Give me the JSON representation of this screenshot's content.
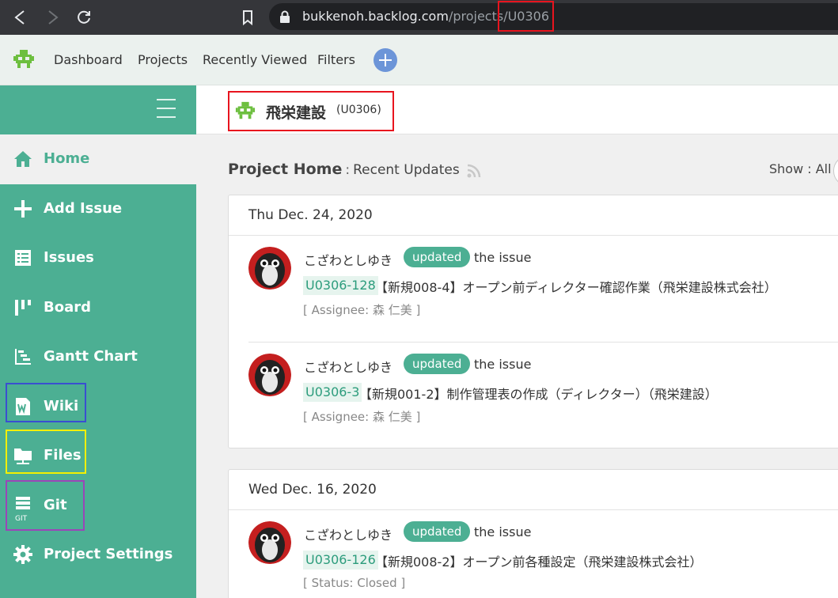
{
  "browser": {
    "url_host": "bukkenoh.backlog.com",
    "url_path": "/projects/",
    "url_key": "U0306"
  },
  "header": {
    "nav": [
      "Dashboard",
      "Projects",
      "Recently Viewed",
      "Filters"
    ]
  },
  "sidebar": {
    "items": [
      {
        "label": "Home",
        "icon": "home-icon"
      },
      {
        "label": "Add Issue",
        "icon": "plus-icon"
      },
      {
        "label": "Issues",
        "icon": "list-icon"
      },
      {
        "label": "Board",
        "icon": "board-icon"
      },
      {
        "label": "Gantt Chart",
        "icon": "gantt-icon"
      },
      {
        "label": "Wiki",
        "icon": "wiki-icon"
      },
      {
        "label": "Files",
        "icon": "files-icon"
      },
      {
        "label": "Git",
        "icon": "git-icon",
        "icon_caption": "GIT"
      },
      {
        "label": "Project Settings",
        "icon": "gear-icon"
      }
    ]
  },
  "project": {
    "name": "飛栄建設",
    "key": "(U0306)"
  },
  "main": {
    "title": "Project Home",
    "separator": ":",
    "subtitle": "Recent Updates",
    "show_label": "Show : All"
  },
  "updates": [
    {
      "date": "Thu Dec. 24, 2020",
      "entries": [
        {
          "user": "こざわとしゆき",
          "badge": "updated",
          "action": "the issue",
          "issue_key": "U0306-128",
          "issue_title": "【新規008-4】オープン前ディレクター確認作業（飛栄建設株式会社）",
          "detail": "[ Assignee: 森 仁美 ]"
        },
        {
          "user": "こざわとしゆき",
          "badge": "updated",
          "action": "the issue",
          "issue_key": "U0306-3",
          "issue_title": "【新規001-2】制作管理表の作成（ディレクター）（飛栄建設）",
          "detail": "[ Assignee: 森 仁美 ]"
        }
      ]
    },
    {
      "date": "Wed Dec. 16, 2020",
      "entries": [
        {
          "user": "こざわとしゆき",
          "badge": "updated",
          "action": "the issue",
          "issue_key": "U0306-126",
          "issue_title": "【新規008-2】オープン前各種設定（飛栄建設株式会社）",
          "detail": "[ Status: Closed ]"
        }
      ]
    }
  ],
  "colors": {
    "accent": "#4caf93",
    "highlight_red": "#e8141e",
    "highlight_blue": "#3a4fd1",
    "highlight_yellow": "#f4f000",
    "highlight_purple": "#9b45b8"
  }
}
